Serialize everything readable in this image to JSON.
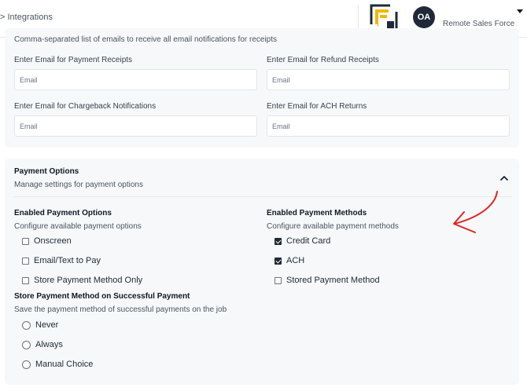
{
  "header": {
    "breadcrumb": "> Integrations",
    "avatar_initials": "OA",
    "company_name": "Remote Sales Force"
  },
  "receipts": {
    "description": "Comma-separated list of emails to receive all email notifications for receipts",
    "fields": [
      {
        "label": "Enter Email for Payment Receipts",
        "placeholder": "Email"
      },
      {
        "label": "Enter Email for Refund Receipts",
        "placeholder": "Email"
      },
      {
        "label": "Enter Email for Chargeback Notifications",
        "placeholder": "Email"
      },
      {
        "label": "Enter Email for ACH Returns",
        "placeholder": "Email"
      }
    ]
  },
  "payment_options": {
    "title": "Payment Options",
    "subtitle": "Manage settings for payment options",
    "enabled_options": {
      "title": "Enabled Payment Options",
      "subtitle": "Configure available payment options",
      "items": [
        {
          "label": "Onscreen",
          "checked": false
        },
        {
          "label": "Email/Text to Pay",
          "checked": false
        },
        {
          "label": "Store Payment Method Only",
          "checked": false
        }
      ]
    },
    "enabled_methods": {
      "title": "Enabled Payment Methods",
      "subtitle": "Configure available payment methods",
      "items": [
        {
          "label": "Credit Card",
          "checked": true
        },
        {
          "label": "ACH",
          "checked": true
        },
        {
          "label": "Stored Payment Method",
          "checked": false
        }
      ]
    },
    "store_method": {
      "title": "Store Payment Method on Successful Payment",
      "subtitle": "Save the payment method of successful payments on the job",
      "items": [
        {
          "label": "Never",
          "selected": false
        },
        {
          "label": "Always",
          "selected": false
        },
        {
          "label": "Manual Choice",
          "selected": false
        }
      ]
    }
  },
  "colors": {
    "logo_gold": "#f2b705",
    "logo_dark": "#1f2937",
    "annotation_arrow": "#e02424"
  },
  "icons": {
    "logo": "company-logo-icon",
    "collapse": "chevron-up-icon",
    "menu": "caret-down-icon",
    "annotation": "red-arrow-annotation"
  }
}
